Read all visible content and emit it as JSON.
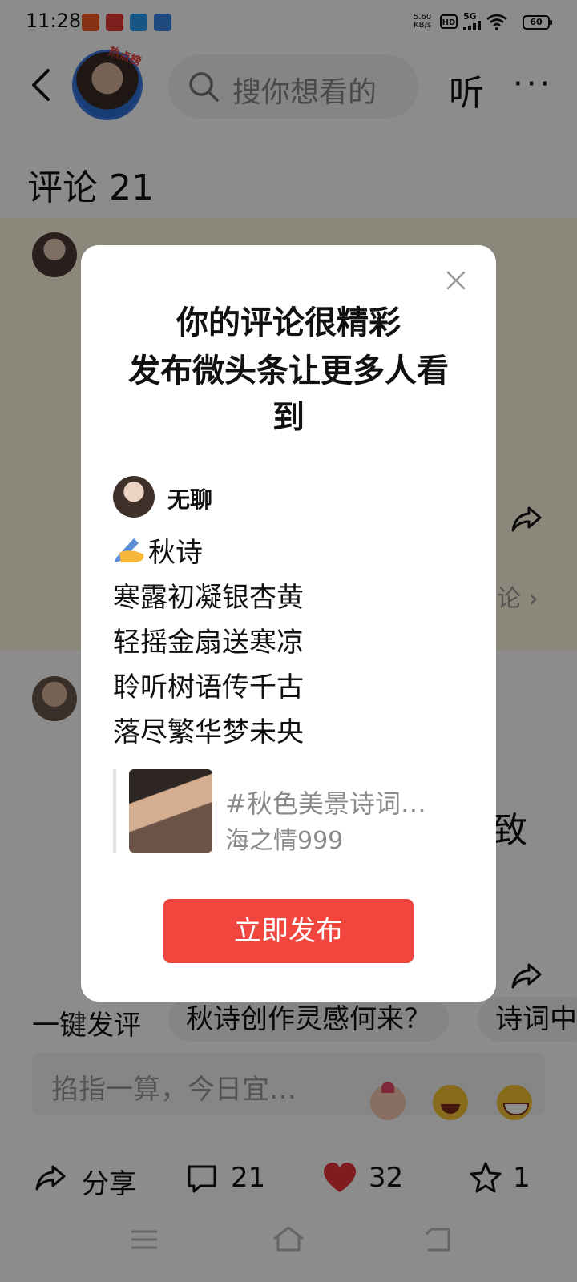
{
  "status_bar": {
    "time": "11:28",
    "net_speed": "5.60",
    "net_unit": "KB/s",
    "hd": "HD",
    "network": "5G",
    "battery": "60"
  },
  "header": {
    "hot_badge": "热点榜",
    "search_placeholder": "搜你想看的",
    "listen": "听",
    "more": "···"
  },
  "comments": {
    "title": "评论 21",
    "peek_more": "论 ›",
    "peek_text": "致"
  },
  "dialog": {
    "title_lines": [
      "你的评论很精彩",
      "发布微头条让更多人看",
      "到"
    ],
    "user_name": "无聊",
    "poem_title": "秋诗",
    "poem_lines": [
      "寒露初凝银杏黄",
      "轻摇金扇送寒凉",
      "聆听树语传千古",
      "落尽繁华梦未央"
    ],
    "card_title": "#秋色美景诗词…",
    "card_author": "海之情999",
    "publish_label": "立即发布"
  },
  "suggestions": {
    "label": "一键发评",
    "chips": [
      "秋诗创作灵感何来？",
      "诗词中"
    ]
  },
  "comment_input": {
    "placeholder": "掐指一算，今日宜…",
    "emojis": [
      "finger-heart-icon",
      "laughing-emoji-icon",
      "grinning-emoji-icon"
    ]
  },
  "actions": {
    "share": "分享",
    "comments": "21",
    "likes": "32",
    "favorites": "1"
  },
  "colors": {
    "accent": "#f0463e",
    "like": "#e8343a",
    "overlay": "rgba(0,0,0,0.45)"
  }
}
